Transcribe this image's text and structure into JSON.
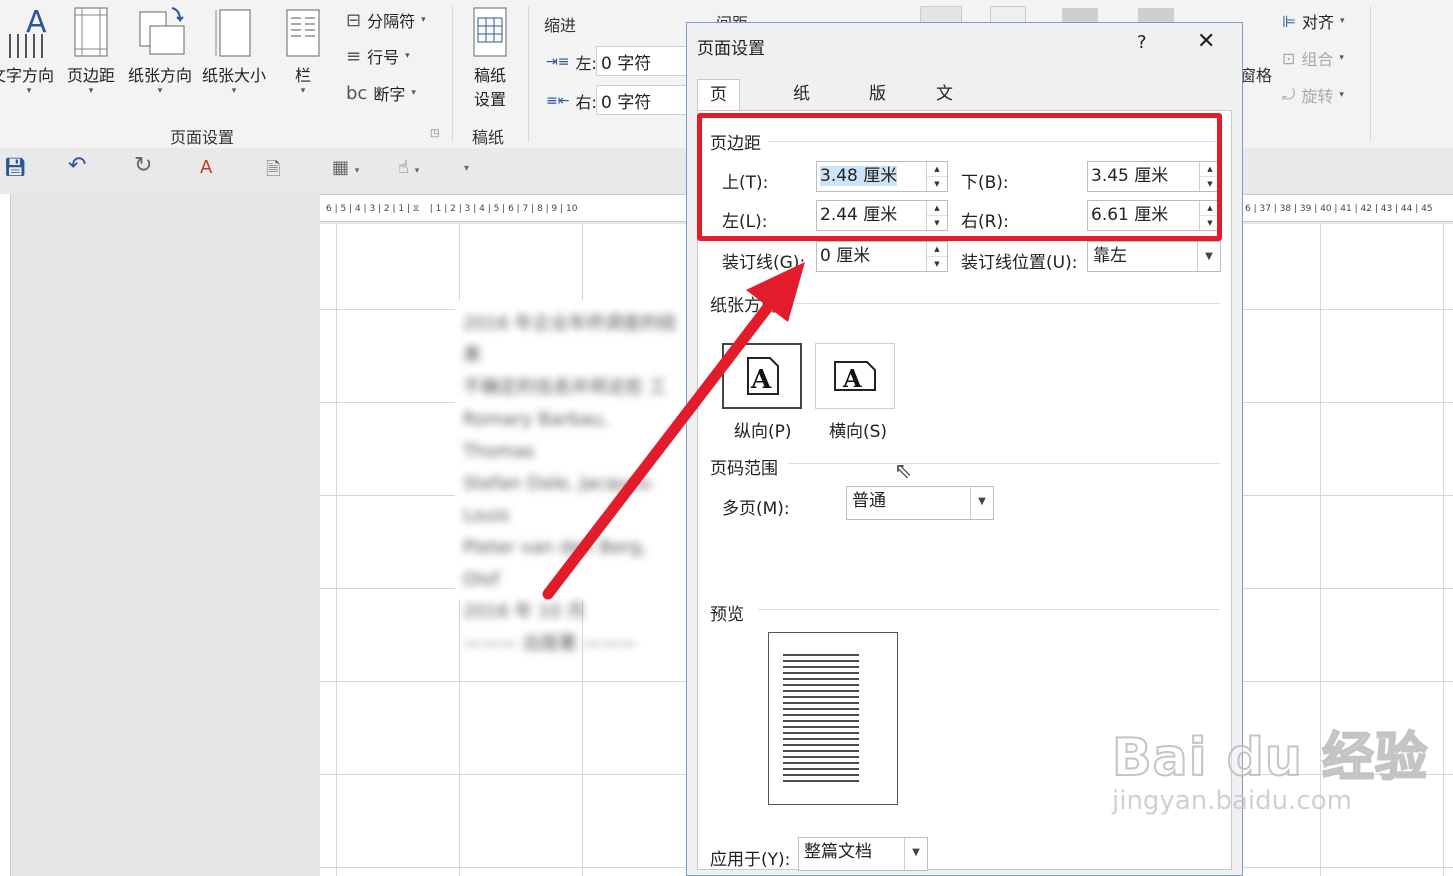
{
  "ribbon": {
    "text_direction": "文字方向",
    "margins": "页边距",
    "orientation": "纸张方向",
    "size": "纸张大小",
    "columns": "栏",
    "breaks": "分隔符",
    "line_numbers": "行号",
    "hyphenation": "断字",
    "page_setup_group": "页面设置",
    "manuscript_btn_line1": "稿纸",
    "manuscript_btn_line2": "设置",
    "manuscript_group": "稿纸",
    "indent_label": "缩进",
    "spacing_label": "间距",
    "indent_left_label": "左:",
    "indent_left_value": "0 字符",
    "indent_right_label": "右:",
    "indent_right_value": "0 字符",
    "pane_partial": "窗格",
    "align": "对齐",
    "group": "组合",
    "rotate": "旋转"
  },
  "ruler_left": "6 | 5 | 4 | 3 | 2 | 1 |",
  "ruler_mid": "| 1 | 2 | 3 | 4 | 5 | 6 | 7 | 8 | 9 | 10",
  "ruler_right": "6 | 37 | 38 | 39 | 40 | 41 | 42 | 43 | 44 | 45",
  "document": {
    "blurred_lines": [
      "2016 年企业年终调查的结果",
      "不确定的信息并将这些 工",
      "",
      "Romary Barbau, Thomas",
      "Stefan Dale, Jacques-Louis",
      "Pieter van den Berg, Olof",
      "2016 年 10 月",
      "——— 出版著 ———"
    ]
  },
  "dialog": {
    "title": "页面设置",
    "help": "?",
    "close": "✕",
    "tabs": [
      "页边距",
      "纸张",
      "版式",
      "文档网格"
    ],
    "margins_section": "页边距",
    "top_label": "上(T):",
    "top_value": "3.48 厘米",
    "bottom_label": "下(B):",
    "bottom_value": "3.45 厘米",
    "left_label": "左(L):",
    "left_value": "2.44 厘米",
    "right_label": "右(R):",
    "right_value": "6.61 厘米",
    "gutter_label": "装订线(G):",
    "gutter_value": "0 厘米",
    "gutter_pos_label": "装订线位置(U):",
    "gutter_pos_value": "靠左",
    "orientation_section": "纸张方向",
    "portrait_label": "纵向(P)",
    "landscape_label": "横向(S)",
    "pages_section": "页码范围",
    "multiple_pages_label": "多页(M):",
    "multiple_pages_value": "普通",
    "preview_section": "预览",
    "apply_label": "应用于(Y):",
    "apply_value": "整篇文档"
  },
  "watermark": {
    "brand": "Bai du 经验",
    "url": "jingyan.baidu.com"
  },
  "colors": {
    "highlight_red": "#e21c2a",
    "selection_blue": "#cde4f7"
  }
}
